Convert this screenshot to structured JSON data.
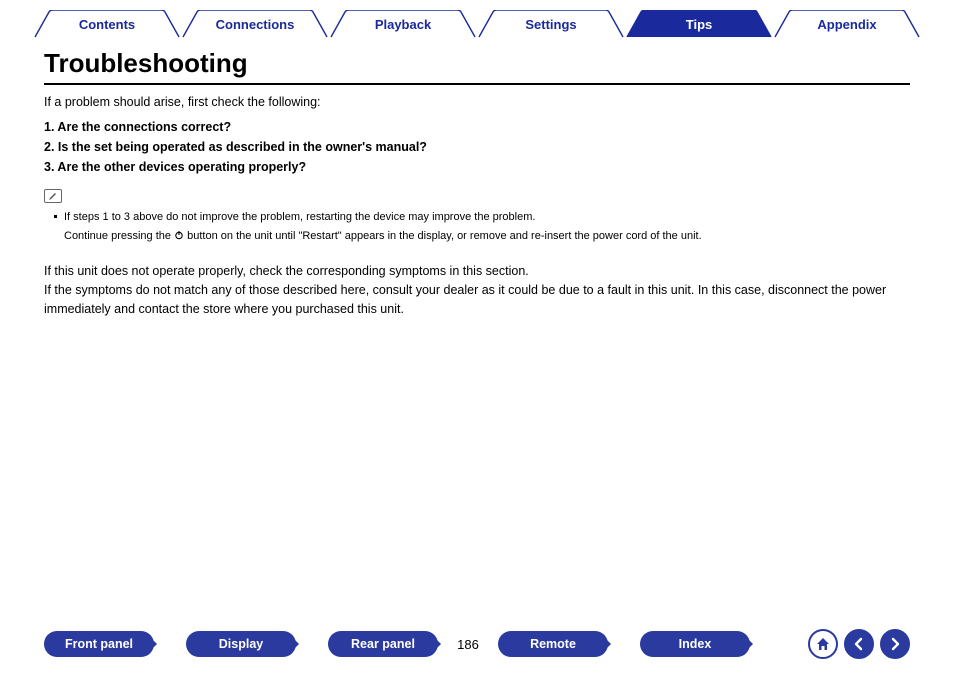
{
  "tabs": {
    "t0": "Contents",
    "t1": "Connections",
    "t2": "Playback",
    "t3": "Settings",
    "t4": "Tips",
    "t5": "Appendix",
    "active": "Tips"
  },
  "title": "Troubleshooting",
  "intro": "If a problem should arise, first check the following:",
  "check1": "1.  Are the connections correct?",
  "check2": "2.  Is the set being operated as described in the owner's manual?",
  "check3": "3.  Are the other devices operating properly?",
  "bullet1": "If steps 1 to 3 above do not improve the problem, restarting the device may improve the problem.",
  "bullet2a": "Continue pressing the ",
  "bullet2b": " button on the unit until \"Restart\" appears in the display, or remove and re-insert the power cord of the unit.",
  "body1": "If this unit does not operate properly, check the corresponding symptoms in this section.",
  "body2": "If the symptoms do not match any of those described here, consult your dealer as it could be due to a fault in this unit. In this case, disconnect the power immediately and contact the store where you purchased this unit.",
  "bottom": {
    "b0": "Front panel",
    "b1": "Display",
    "b2": "Rear panel",
    "b3": "Remote",
    "b4": "Index",
    "page": "186"
  }
}
